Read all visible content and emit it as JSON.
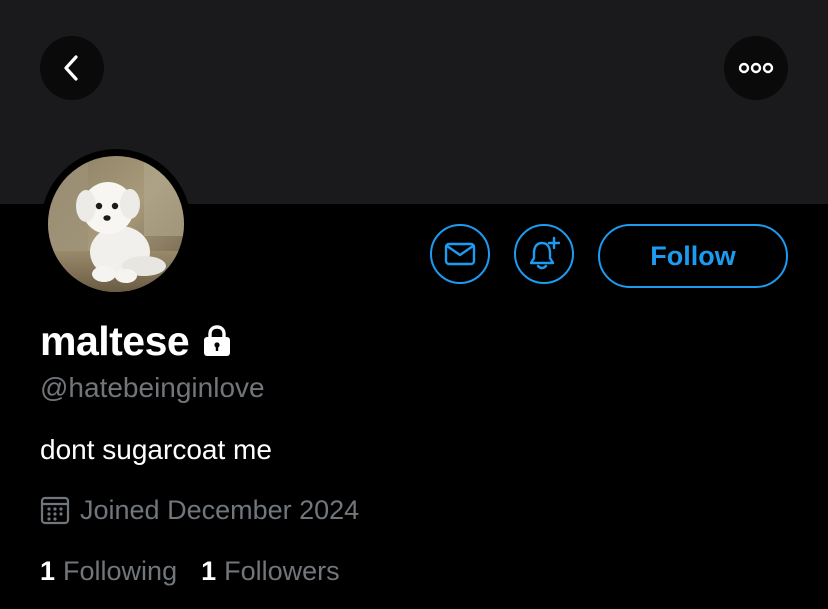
{
  "header": {
    "back_icon": "chevron-left-icon",
    "more_icon": "more-dots-icon"
  },
  "profile": {
    "avatar": "white maltese puppy photo",
    "display_name": "maltese",
    "locked": true,
    "handle": "@hatebeinginlove",
    "bio": "dont sugarcoat me",
    "joined": "Joined December 2024",
    "following_count": "1",
    "following_label": "Following",
    "followers_count": "1",
    "followers_label": "Followers"
  },
  "actions": {
    "message_icon": "envelope-icon",
    "notify_icon": "bell-plus-icon",
    "follow_label": "Follow"
  },
  "colors": {
    "accent": "#1d9bf0",
    "background": "#000000",
    "banner": "#1a1a1c",
    "muted_text": "#71767b",
    "primary_text": "#ffffff"
  }
}
